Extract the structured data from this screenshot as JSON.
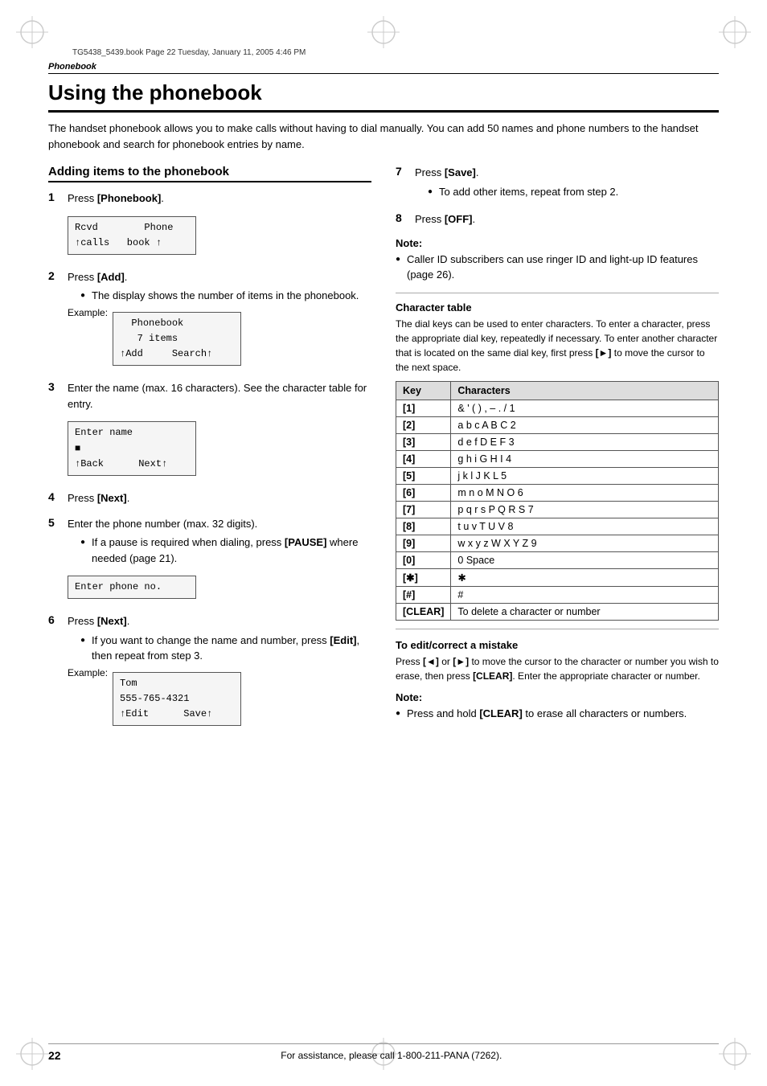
{
  "file_info": "TG5438_5439.book  Page 22  Tuesday, January 11, 2005  4:46 PM",
  "section_header": "Phonebook",
  "page_title": "Using the phonebook",
  "intro": "The handset phonebook allows you to make calls without having to dial manually. You can add 50 names and phone numbers to the handset phonebook and search for phonebook entries by name.",
  "subsection_title": "Adding items to the phonebook",
  "steps": [
    {
      "number": "1",
      "text": "Press ",
      "bold": "[Phonebook]",
      "after": ".",
      "lcd": {
        "lines": [
          "Rcvd        Phone",
          "↑calls    book↑"
        ],
        "show": true
      }
    },
    {
      "number": "2",
      "text": "Press ",
      "bold": "[Add]",
      "after": ".",
      "bullets": [
        "The display shows the number of items in the phonebook."
      ],
      "example": {
        "label": "Example:",
        "lcd_lines": [
          "  Phonebook",
          "   7 items",
          "↑Add     Search↑"
        ]
      }
    },
    {
      "number": "3",
      "text": "Enter the name (max. 16 characters). See the character table for entry.",
      "lcd": {
        "lines": [
          "Enter name",
          "■",
          "↑Back       Next↑"
        ],
        "show": true
      }
    },
    {
      "number": "4",
      "text": "Press ",
      "bold": "[Next]",
      "after": "."
    },
    {
      "number": "5",
      "text": "Enter the phone number (max. 32 digits).",
      "bullets": [
        "If a pause is required when dialing, press [PAUSE] where needed (page 21)."
      ],
      "lcd": {
        "lines": [
          "Enter phone no."
        ],
        "show": true
      }
    },
    {
      "number": "6",
      "text": "Press ",
      "bold": "[Next]",
      "after": ".",
      "bullets": [
        "If you want to change the name and number, press [Edit], then repeat from step 3."
      ],
      "example": {
        "label": "Example:",
        "lcd_lines": [
          "Tom",
          "555-765-4321",
          "↑Edit        Save↑"
        ]
      }
    }
  ],
  "right_steps": [
    {
      "number": "7",
      "text": "Press ",
      "bold": "[Save]",
      "after": ".",
      "bullets": [
        "To add other items, repeat from step 2."
      ]
    },
    {
      "number": "8",
      "text": "Press ",
      "bold": "[OFF]",
      "after": "."
    }
  ],
  "note1": {
    "label": "Note:",
    "bullets": [
      "Caller ID subscribers can use ringer ID and light-up ID features (page 26)."
    ]
  },
  "char_table": {
    "title": "Character table",
    "intro": "The dial keys can be used to enter characters. To enter a character, press the appropriate dial key, repeatedly if necessary. To enter another character that is located on the same dial key, first press [►] to move the cursor to the next space.",
    "headers": [
      "Key",
      "Characters"
    ],
    "rows": [
      {
        "key": "[1]",
        "chars": "& ' ( ) , – . / 1"
      },
      {
        "key": "[2]",
        "chars": "a b c A B C 2"
      },
      {
        "key": "[3]",
        "chars": "d e f D E F 3"
      },
      {
        "key": "[4]",
        "chars": "g h i G H I 4"
      },
      {
        "key": "[5]",
        "chars": "j k l J K L 5"
      },
      {
        "key": "[6]",
        "chars": "m n o M N O 6"
      },
      {
        "key": "[7]",
        "chars": "p q r s P Q R S 7"
      },
      {
        "key": "[8]",
        "chars": "t u v T U V 8"
      },
      {
        "key": "[9]",
        "chars": "w x y z W X Y Z 9"
      },
      {
        "key": "[0]",
        "chars": "0  Space"
      },
      {
        "key": "[✱]",
        "chars": "✱"
      },
      {
        "key": "[#]",
        "chars": "#"
      },
      {
        "key": "[CLEAR]",
        "chars": "To delete a character or number"
      }
    ]
  },
  "edit_mistake": {
    "title": "To edit/correct a mistake",
    "text": "Press [◄] or [►] to move the cursor to the character or number you wish to erase, then press [CLEAR]. Enter the appropriate character or number."
  },
  "note2": {
    "label": "Note:",
    "bullets": [
      "Press and hold [CLEAR] to erase all characters or numbers."
    ]
  },
  "footer": {
    "page_number": "22",
    "support_text": "For assistance, please call 1-800-211-PANA (7262)."
  }
}
